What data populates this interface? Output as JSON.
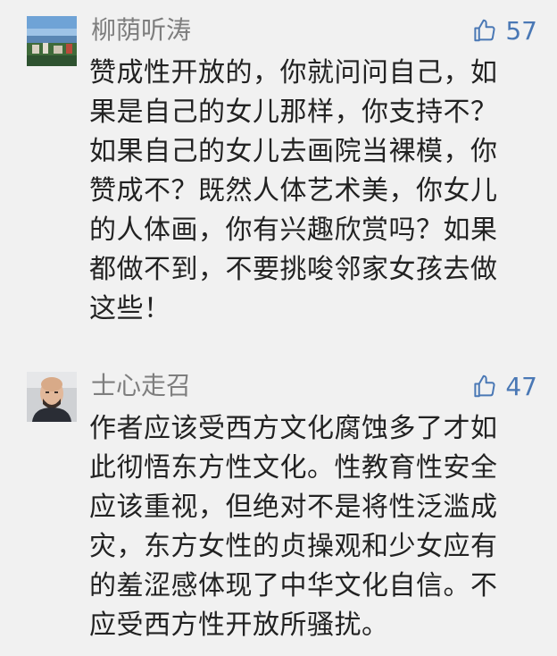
{
  "comments": [
    {
      "username": "柳荫听涛",
      "likes": "57",
      "avatar": "harbor-scene-avatar",
      "text": "赞成性开放的，你就问问自己，如\n果是自己的女儿那样，你支持不？\n如果自己的女儿去画院当裸模，你\n赞成不？既然人体艺术美，你女儿\n的人体画，你有兴趣欣赏吗？如果\n都做不到，不要挑唆邻家女孩去做\n这些！"
    },
    {
      "username": "士心走召",
      "likes": "47",
      "avatar": "bald-man-avatar",
      "text": "作者应该受西方文化腐蚀多了才如\n此彻悟东方性文化。性教育性安全\n应该重视，但绝对不是将性泛滥成\n灾，东方女性的贞操观和少女应有\n的羞涩感体现了中华文化自信。不\n应受西方性开放所骚扰。"
    }
  ],
  "colors": {
    "background": "#f1f1f1",
    "username": "#7e7e7e",
    "like_accent": "#4a78b5",
    "text": "#222222"
  },
  "icons": {
    "like": "thumbs-up-icon"
  }
}
